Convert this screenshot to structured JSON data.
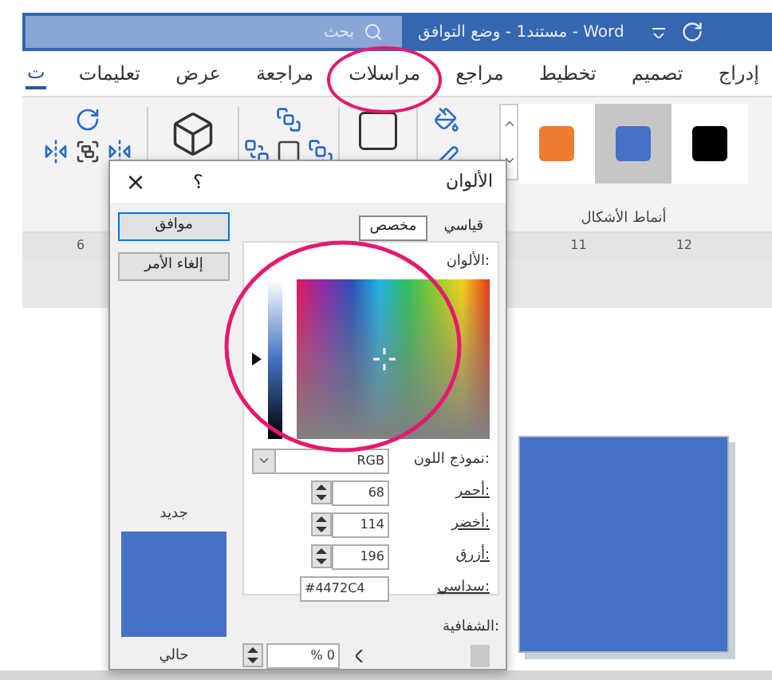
{
  "title_bar": {
    "search_placeholder": "بحث",
    "title": "مستند1 - وضع التوافق - Word"
  },
  "tabs": [
    {
      "label": "إدراج",
      "selected": false
    },
    {
      "label": "تصميم",
      "selected": false
    },
    {
      "label": "تخطيط",
      "selected": false
    },
    {
      "label": "مراجع",
      "selected": false
    },
    {
      "label": "مراسلات",
      "selected": false
    },
    {
      "label": "مراجعة",
      "selected": false
    },
    {
      "label": "عرض",
      "selected": false
    },
    {
      "label": "تعليمات",
      "selected": false
    },
    {
      "label": "ت",
      "selected": true
    }
  ],
  "ribbon": {
    "swatches": [
      {
        "color": "#000000",
        "selected": false
      },
      {
        "color": "#4472c4",
        "selected": true
      },
      {
        "color": "#ed7d31",
        "selected": false
      }
    ],
    "group_label": "أنماط الأشكال"
  },
  "ruler": {
    "right_labels": [
      "12",
      "11"
    ],
    "left_labels": [
      "6"
    ]
  },
  "dialog": {
    "title": "الألوان",
    "help": "؟",
    "close": "×",
    "ok": "موافق",
    "cancel": "إلغاء الأمر",
    "tabs": [
      {
        "label": "قياسي",
        "selected": false
      },
      {
        "label": "مخصص",
        "selected": true
      }
    ],
    "colors_label": "الألوان:",
    "color_model": {
      "label": "نموذج اللون:",
      "value": "RGB"
    },
    "channels": [
      {
        "label": "أحمر:",
        "value": "68"
      },
      {
        "label": "أخضر:",
        "value": "114"
      },
      {
        "label": "أزرق:",
        "value": "196"
      }
    ],
    "hex": {
      "label": "سداسي:",
      "value": "#4472C4"
    },
    "transparency": {
      "label": "الشفافية:",
      "value": "% 0",
      "level": 0
    },
    "new_label": "جديد",
    "current_label": "حالي",
    "preview": {
      "color": "#4472c4"
    }
  }
}
